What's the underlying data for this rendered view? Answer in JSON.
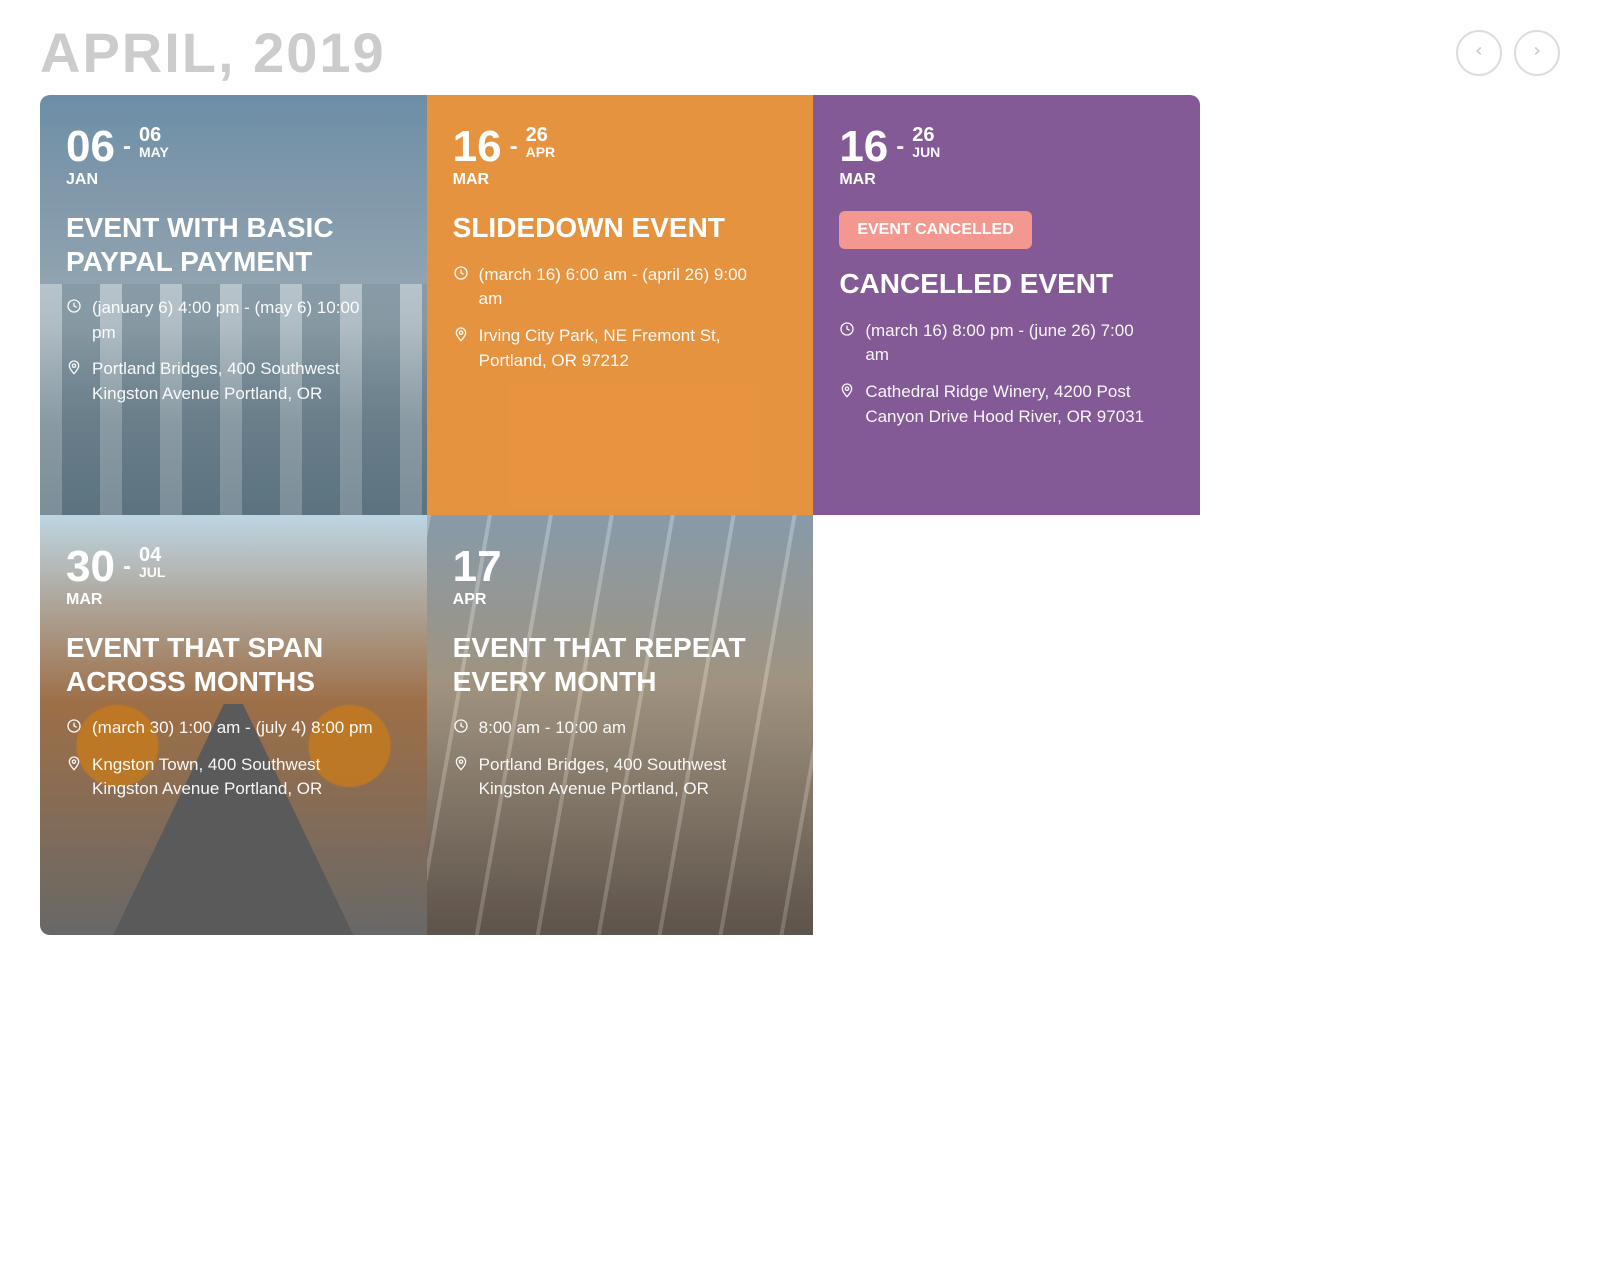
{
  "header": {
    "title": "APRIL, 2019"
  },
  "events": [
    {
      "start_day": "06",
      "start_month": "JAN",
      "end_day": "06",
      "end_month": "MAY",
      "title": "EVENT WITH BASIC PAYPAL PAYMENT",
      "time": "(january 6) 4:00 pm - (may 6) 10:00 pm",
      "location": "Portland Bridges, 400 Southwest Kingston Avenue Portland, OR"
    },
    {
      "start_day": "16",
      "start_month": "MAR",
      "end_day": "26",
      "end_month": "APR",
      "title": "SLIDEDOWN EVENT",
      "time": "(march 16) 6:00 am - (april 26) 9:00 am",
      "location": "Irving City Park, NE Fremont St, Portland, OR 97212"
    },
    {
      "start_day": "16",
      "start_month": "MAR",
      "end_day": "26",
      "end_month": "JUN",
      "badge": "EVENT CANCELLED",
      "title": "CANCELLED EVENT",
      "time": "(march 16) 8:00 pm - (june 26) 7:00 am",
      "location": "Cathedral Ridge Winery, 4200 Post Canyon Drive Hood River, OR 97031"
    },
    {
      "start_day": "30",
      "start_month": "MAR",
      "end_day": "04",
      "end_month": "JUL",
      "title": "EVENT THAT SPAN ACROSS MONTHS",
      "time": "(march 30) 1:00 am - (july 4) 8:00 pm",
      "location": "Kngston Town, 400 Southwest Kingston Avenue Portland, OR"
    },
    {
      "start_day": "17",
      "start_month": "APR",
      "end_day": "",
      "end_month": "",
      "title": "EVENT THAT REPEAT EVERY MONTH",
      "time": "8:00 am - 10:00 am",
      "location": "Portland Bridges, 400 Southwest Kingston Avenue Portland, OR"
    }
  ],
  "card_styles": [
    "city",
    "orange",
    "purple",
    "road",
    "street"
  ]
}
